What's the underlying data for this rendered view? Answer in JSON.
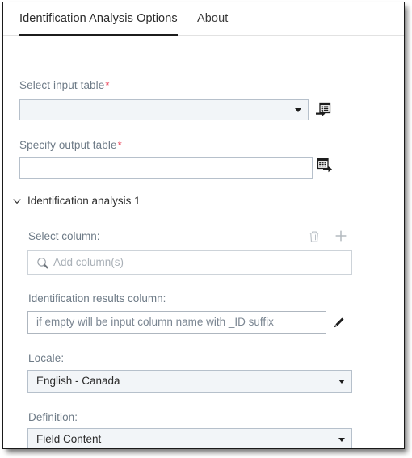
{
  "window": {
    "tabs": [
      {
        "label": "Identification Analysis Options",
        "active": true
      },
      {
        "label": "About",
        "active": false
      }
    ]
  },
  "form": {
    "input_table": {
      "label": "Select input table",
      "required_marker": "*",
      "value": "",
      "icon": "import-table-icon"
    },
    "output_table": {
      "label": "Specify output table",
      "required_marker": "*",
      "value": "",
      "icon": "export-table-icon"
    },
    "section": {
      "title": "Identification analysis 1",
      "chevron_icon": "chevron-down-icon",
      "select_column": {
        "label": "Select column:",
        "delete_icon": "trash-icon",
        "add_icon": "plus-icon",
        "search_icon": "search-icon",
        "placeholder": "Add column(s)",
        "value": ""
      },
      "results_column": {
        "label": "Identification results column:",
        "placeholder": "if empty will be input column name with _ID suffix",
        "value": "",
        "edit_icon": "pencil-icon"
      },
      "locale": {
        "label": "Locale:",
        "value": "English - Canada"
      },
      "definition": {
        "label": "Definition:",
        "value": "Field Content"
      }
    }
  },
  "colors": {
    "required": "#e8334a",
    "label": "#6e7b87",
    "active_tab_underline": "#1c1c1c",
    "combo_fill": "#f2f5f8",
    "border": "#b6c0cb"
  }
}
